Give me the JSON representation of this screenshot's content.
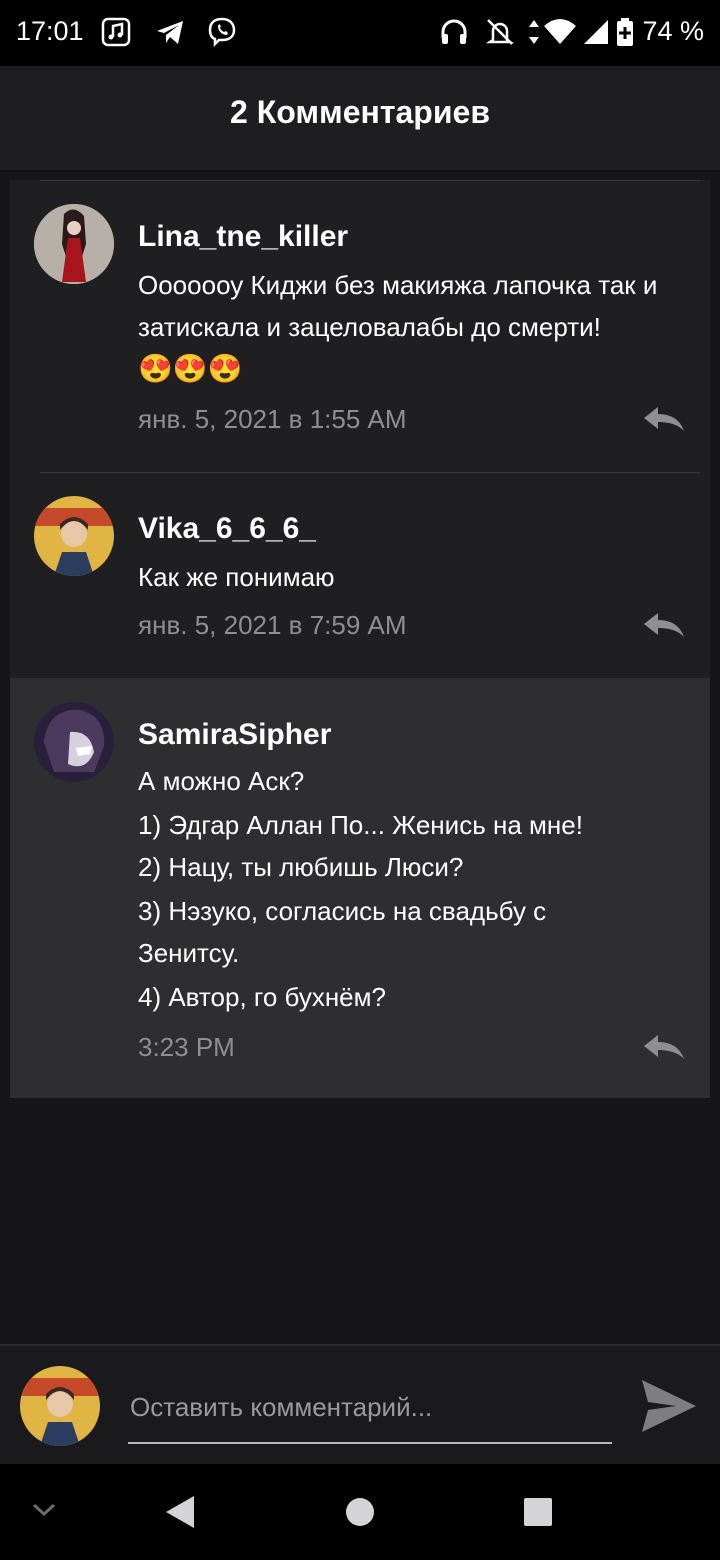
{
  "status": {
    "time": "17:01",
    "battery_text": "74 %",
    "icons": [
      "music-icon",
      "telegram-icon",
      "viber-icon",
      "headphones-icon",
      "bell-off-icon",
      "data-arrows-icon",
      "wifi-icon",
      "signal-icon",
      "battery-icon"
    ]
  },
  "header": {
    "title": "2 Комментариев"
  },
  "comments": [
    {
      "author": "Lina_tne_killer",
      "text": "Ооооооу Киджи без макияжа лапочка так и затискала и зацеловалабы до смерти!",
      "emoji": "😍😍😍",
      "time": "янв. 5, 2021 в 1:55 AM"
    },
    {
      "author": "Vika_6_6_6_",
      "text": "Как же понимаю",
      "time": "янв. 5, 2021 в 7:59 AM"
    },
    {
      "author": "SamiraSipher",
      "lines": [
        "А можно Аск?",
        "1) Эдгар Аллан По... Женись на мне!",
        "2) Нацу, ты любишь Люси?",
        "3) Нэзуко, согласись на свадьбу с Зенитсу.",
        "4) Автор, го бухнём?"
      ],
      "time": "3:23 PM"
    }
  ],
  "input": {
    "placeholder": "Оставить комментарий..."
  },
  "colors": {
    "background": "#161517",
    "card": "#1f1e20",
    "highlight_card": "#2e2d30",
    "muted_text": "#8f8e92"
  }
}
